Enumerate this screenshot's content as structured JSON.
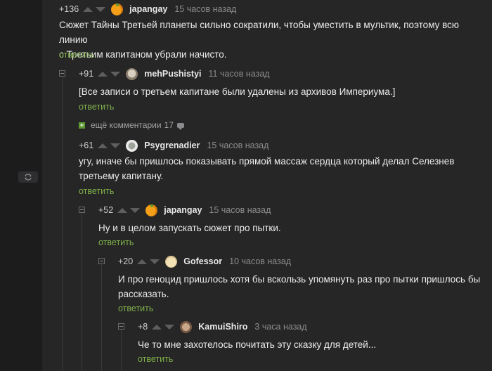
{
  "comments": [
    {
      "rating": "+136",
      "author": "japangay",
      "time": "15 часов назад",
      "lines": [
        "Сюжет Тайны Третьей планеты сильно сократили, чтобы уместить в мультик, поэтому всю линию",
        "с Третьим капитаном убрали начисто."
      ],
      "reply": "ответить",
      "avatar": "orange-avatar"
    },
    {
      "rating": "+91",
      "author": "mehPushistyi",
      "time": "11 часов назад",
      "lines": [
        "[Все записи о третьем капитане были удалены из архивов Империума.]"
      ],
      "reply": "ответить",
      "avatar": "cat-avatar"
    },
    {
      "rating": "+61",
      "author": "Psygrenadier",
      "time": "15 часов назад",
      "lines": [
        "угу, иначе бы пришлось показывать прямой массаж сердца который делал Селезнев",
        "третьему капитану."
      ],
      "reply": "ответить",
      "avatar": "soldier-avatar"
    },
    {
      "rating": "+52",
      "author": "japangay",
      "time": "15 часов назад",
      "lines": [
        "Ну и в целом запускать сюжет про пытки."
      ],
      "reply": "ответить",
      "avatar": "orange-avatar"
    },
    {
      "rating": "+20",
      "author": "Gofessor",
      "time": "10 часов назад",
      "lines": [
        "И про геноцид пришлось хотя бы вскользь упомянуть раз про пытки пришлось бы",
        "рассказать."
      ],
      "reply": "ответить",
      "avatar": "beige-avatar"
    },
    {
      "rating": "+8",
      "author": "KamuiShiro",
      "time": "3 часа назад",
      "lines": [
        "Че то мне захотелось почитать эту сказку для детей..."
      ],
      "reply": "ответить",
      "avatar": "cat-avatar"
    }
  ],
  "more_comments": {
    "label": "ещё комментарии",
    "count": "17"
  },
  "colors": {
    "accent_link": "#7fb048",
    "panel_bg": "#262627",
    "page_bg": "#1c1c1d"
  }
}
